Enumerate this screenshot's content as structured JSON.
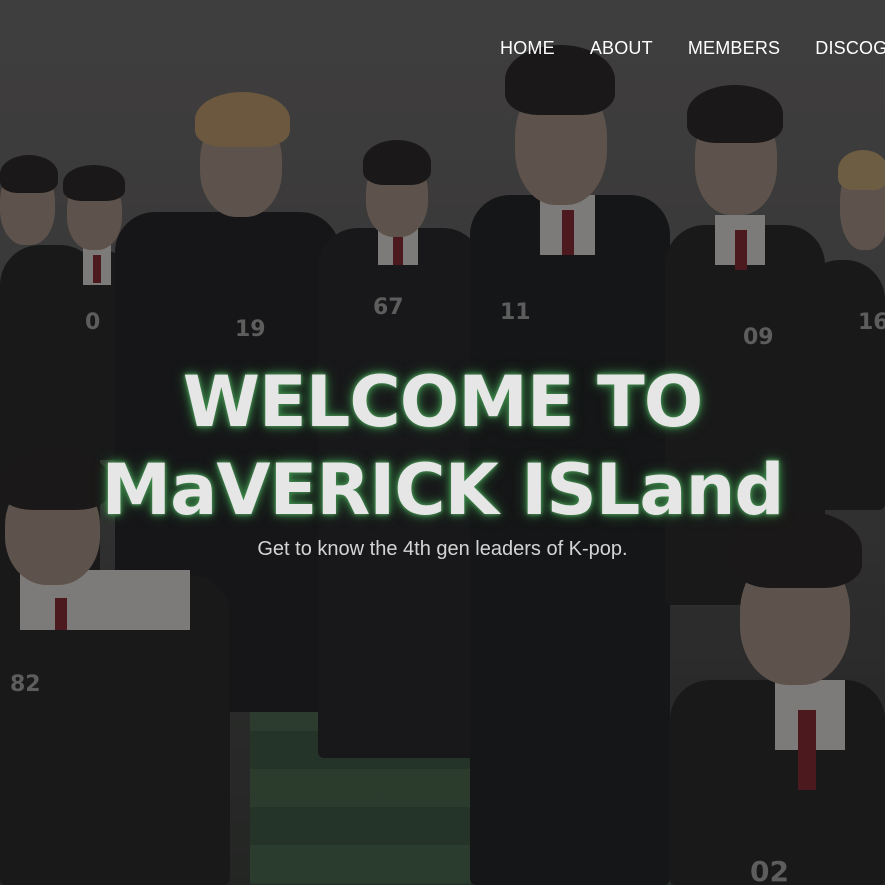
{
  "nav": {
    "items": [
      {
        "label": "HOME"
      },
      {
        "label": "ABOUT"
      },
      {
        "label": "MEMBERS"
      },
      {
        "label": "DISCOG"
      }
    ]
  },
  "hero": {
    "headline_line1": "WELCOME TO",
    "headline_line2": "MaVERICK ISLand",
    "tagline": "Get to know the 4th gen leaders of K-pop.",
    "glow_color": "#3d8a4a",
    "vest_numbers": [
      "19",
      "67",
      "11",
      "09",
      "16",
      "82",
      "02",
      "0"
    ]
  }
}
